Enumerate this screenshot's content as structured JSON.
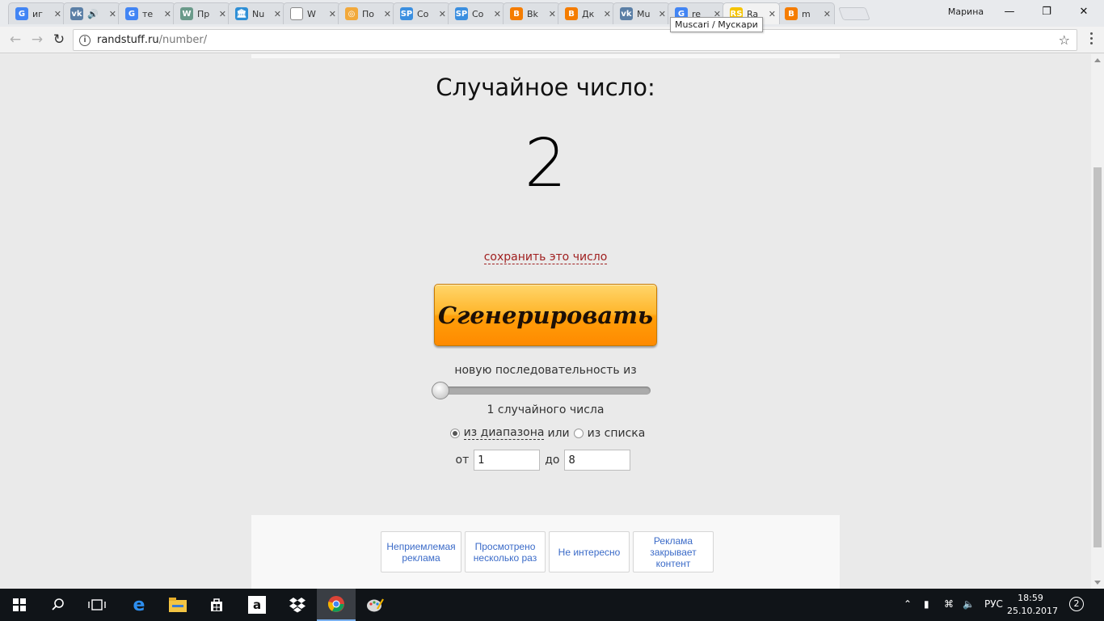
{
  "browser": {
    "tabs": [
      {
        "icon": "google-icon",
        "favicon_text": "G",
        "favicon_color": "#4285f4",
        "title": "иг"
      },
      {
        "icon": "vk-icon",
        "favicon_text": "vk",
        "favicon_color": "#5b7fa6",
        "title": "🔊"
      },
      {
        "icon": "google-icon",
        "favicon_text": "G",
        "favicon_color": "#4285f4",
        "title": "те"
      },
      {
        "icon": "wiki-icon",
        "favicon_text": "W",
        "favicon_color": "#6a9a8a",
        "title": "Пр"
      },
      {
        "icon": "museum-icon",
        "favicon_text": "🏛",
        "favicon_color": "#2e8fd6",
        "title": "Nu"
      },
      {
        "icon": "page-icon",
        "favicon_text": "",
        "favicon_color": "#ffffff",
        "title": "W"
      },
      {
        "icon": "globe-icon",
        "favicon_text": "◎",
        "favicon_color": "#f2a93b",
        "title": "По"
      },
      {
        "icon": "sp-icon",
        "favicon_text": "SP",
        "favicon_color": "#3b8fe0",
        "title": "Со"
      },
      {
        "icon": "sp-icon",
        "favicon_text": "SP",
        "favicon_color": "#3b8fe0",
        "title": "Со"
      },
      {
        "icon": "blogger-icon",
        "favicon_text": "B",
        "favicon_color": "#f57d00",
        "title": "Вk"
      },
      {
        "icon": "blogger-icon",
        "favicon_text": "B",
        "favicon_color": "#f57d00",
        "title": "Дк"
      },
      {
        "icon": "vk-icon",
        "favicon_text": "vk",
        "favicon_color": "#5b7fa6",
        "title": "Mu"
      },
      {
        "icon": "google-icon",
        "favicon_text": "G",
        "favicon_color": "#4285f4",
        "title": "re"
      },
      {
        "icon": "randstuff-icon",
        "favicon_text": "RS",
        "favicon_color": "#f5c400",
        "title": "Ra",
        "active": true
      },
      {
        "icon": "blogger-icon",
        "favicon_text": "B",
        "favicon_color": "#f57d00",
        "title": "m"
      }
    ],
    "profile_name": "Марина",
    "tooltip": "Muscari / Мускари",
    "url_host": "randstuff.ru",
    "url_path": "/number/"
  },
  "page": {
    "heading": "Случайное число:",
    "result": "2",
    "save_link": "сохранить это число",
    "generate_button": "Сгенерировать",
    "sequence_label": "новую последовательность из",
    "count_label": "1 случайного числа",
    "slider_value": 1,
    "mode": {
      "range_label": "из диапазона",
      "or": "или",
      "list_label": "из списка",
      "selected": "range"
    },
    "range": {
      "from_label": "от",
      "from_value": "1",
      "to_label": "до",
      "to_value": "8"
    },
    "ad_feedback": [
      "Неприемлемая реклама",
      "Просмотрено несколько раз",
      "Не интересно",
      "Реклама закрывает контент"
    ]
  },
  "taskbar": {
    "language": "РУС",
    "time": "18:59",
    "date": "25.10.2017",
    "notifications": "2"
  },
  "colors": {
    "accent_orange": "#ff9f0a",
    "link_red": "#a02020",
    "ad_link_blue": "#3b6bc8"
  }
}
